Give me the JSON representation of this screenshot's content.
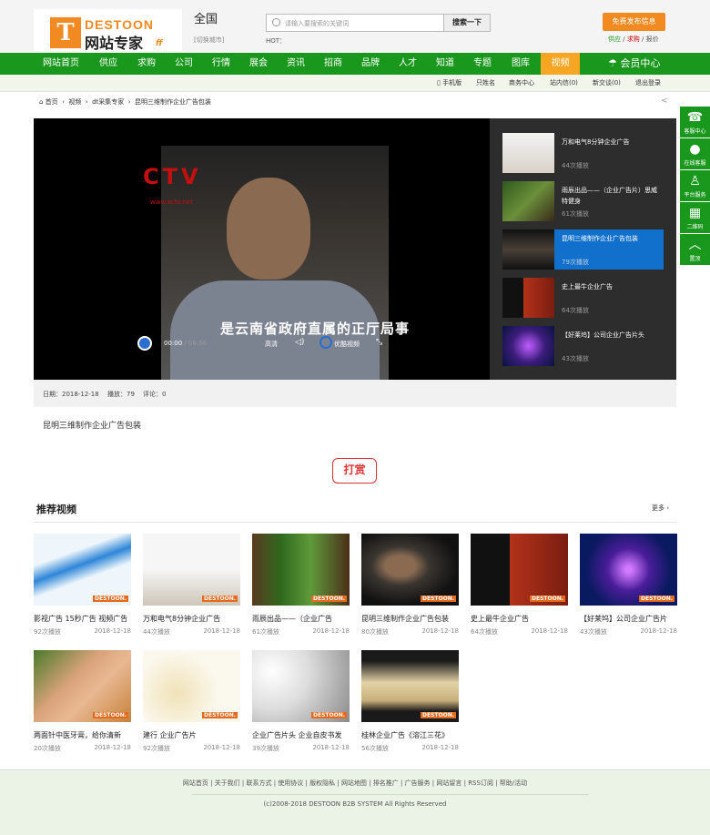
{
  "header": {
    "logo_en": "DESTOON",
    "logo_cn": "网站专家",
    "logo_mark": "ff",
    "city": "全国",
    "city_switch": "[切换城市]",
    "search_placeholder": "请输入要搜索的关键词",
    "search_button": "搜索一下",
    "hot_label": "HOT：",
    "publish_button": "免费发布信息",
    "publish_links": [
      "供应",
      "求购",
      "报价"
    ]
  },
  "nav": {
    "items": [
      "网站首页",
      "供应",
      "求购",
      "公司",
      "行情",
      "展会",
      "资讯",
      "招商",
      "品牌",
      "人才",
      "知道",
      "专题",
      "图库",
      "视频"
    ],
    "active": "视频",
    "member_center": "会员中心"
  },
  "subnav": [
    "手机版",
    "只姓名",
    "商务中心",
    "站内信(0)",
    "新交谈(0)",
    "退出登录"
  ],
  "breadcrumb": [
    "首页",
    "视频",
    "dt采集专家",
    "昆明三维制作企业广告包装"
  ],
  "player": {
    "overlay_logo": "CTV",
    "overlay_site": "www.actv.net",
    "subtitle": "是云南省政府直属的正厅局事",
    "time_current": "00:00",
    "time_total": "/ 08:56",
    "quality": "高清",
    "youku": "优酷视频"
  },
  "playlist": [
    {
      "title": "万和电气8分钟企业广告",
      "views": "44次播放",
      "active": false
    },
    {
      "title": "雨辰出品——（企业广告片）思威特健身",
      "views": "61次播放",
      "active": false
    },
    {
      "title": "昆明三维制作企业广告包装",
      "views": "79次播放",
      "active": true
    },
    {
      "title": "史上最牛企业广告",
      "views": "64次播放",
      "active": false
    },
    {
      "title": "【好莱坞】公司企业广告片头",
      "views": "43次播放",
      "active": false
    }
  ],
  "meta": {
    "date": "日期：2018-12-18",
    "plays": "播放：79",
    "comments": "评论：0"
  },
  "description": "昆明三维制作企业广告包装",
  "reward": "打赏",
  "recommend": {
    "title": "推荐视频",
    "more": "更多",
    "watermark": "DESTOON.",
    "items": [
      {
        "title": "影视广告 15秒广告 视频广告",
        "views": "92次播放",
        "date": "2018-12-18"
      },
      {
        "title": "万和电气8分钟企业广告",
        "views": "44次播放",
        "date": "2018-12-18"
      },
      {
        "title": "雨辰出品——（企业广告",
        "views": "61次播放",
        "date": "2018-12-18"
      },
      {
        "title": "昆明三维制作企业广告包装",
        "views": "80次播放",
        "date": "2018-12-18"
      },
      {
        "title": "史上最牛企业广告",
        "views": "64次播放",
        "date": "2018-12-18"
      },
      {
        "title": "【好莱坞】公司企业广告片",
        "views": "43次播放",
        "date": "2018-12-18"
      },
      {
        "title": "两面针中医牙膏，给你清新",
        "views": "20次播放",
        "date": "2018-12-18"
      },
      {
        "title": "建行 企业广告片",
        "views": "92次播放",
        "date": "2018-12-18"
      },
      {
        "title": "企业广告片头 企业自皮书发",
        "views": "39次播放",
        "date": "2018-12-18"
      },
      {
        "title": "桂林企业广告《溶江三花》",
        "views": "56次播放",
        "date": "2018-12-18"
      }
    ]
  },
  "footer": {
    "links": [
      "网站首页",
      "关于我们",
      "联系方式",
      "使用协议",
      "版权隐私",
      "网站地图",
      "排名推广",
      "广告服务",
      "网站留言",
      "RSS订阅",
      "帮助/活动"
    ],
    "copyright": "(c)2008-2018 DESTOON B2B SYSTEM All Rights Reserved"
  },
  "sidebar": [
    "客服中心",
    "在线客服",
    "平台服务",
    "二维码",
    "置顶"
  ],
  "colors": {
    "brand_green": "#19981d",
    "accent_orange": "#f7a623",
    "active_blue": "#1170cc",
    "reward_red": "#dd3333"
  }
}
